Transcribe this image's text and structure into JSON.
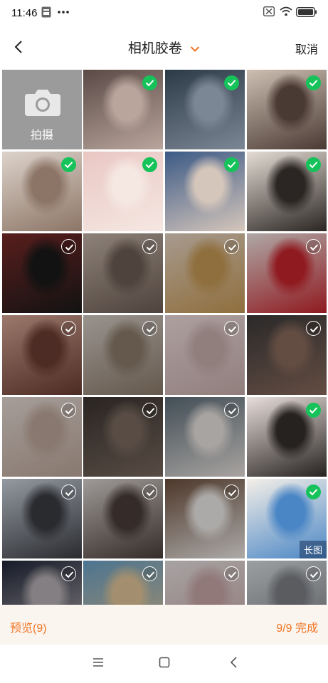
{
  "status": {
    "time": "11:46"
  },
  "header": {
    "back_icon": "chevron-left-icon",
    "title": "相机胶卷",
    "cancel": "取消",
    "accent": "#f07422"
  },
  "camera_tile": {
    "label": "拍摄",
    "icon": "camera-icon"
  },
  "photos": [
    {
      "selected": true,
      "colors": [
        "#5a4a46",
        "#b9a59c"
      ]
    },
    {
      "selected": true,
      "colors": [
        "#2c3a48",
        "#7c8795"
      ]
    },
    {
      "selected": true,
      "colors": [
        "#cdbfb2",
        "#4a3a34"
      ]
    },
    {
      "selected": true,
      "colors": [
        "#ddd3cb",
        "#8c7566"
      ]
    },
    {
      "selected": true,
      "colors": [
        "#e9c7c3",
        "#f5e7e2"
      ]
    },
    {
      "selected": true,
      "colors": [
        "#3c5a86",
        "#d5c6bb"
      ]
    },
    {
      "selected": true,
      "colors": [
        "#e4dcd4",
        "#2b2623"
      ]
    },
    {
      "selected": false,
      "colors": [
        "#7b2a28",
        "#1a1a1a"
      ]
    },
    {
      "selected": false,
      "colors": [
        "#c4b4a8",
        "#6e5e55"
      ]
    },
    {
      "selected": false,
      "colors": [
        "#e8d6c6",
        "#c79a55"
      ]
    },
    {
      "selected": false,
      "colors": [
        "#f2e9e6",
        "#c7252d"
      ]
    },
    {
      "selected": false,
      "colors": [
        "#d9a796",
        "#6a3d32"
      ]
    },
    {
      "selected": false,
      "colors": [
        "#d5cdc6",
        "#8c7b6b"
      ]
    },
    {
      "selected": false,
      "colors": [
        "#f0dede",
        "#c9b0ad"
      ]
    },
    {
      "selected": false,
      "colors": [
        "#3b3a3a",
        "#8a6b5d"
      ]
    },
    {
      "selected": false,
      "colors": [
        "#e6dbd5",
        "#bda79a"
      ]
    },
    {
      "selected": false,
      "colors": [
        "#3a3330",
        "#7a6a5f"
      ]
    },
    {
      "selected": false,
      "colors": [
        "#5c6d78",
        "#e9e3df"
      ]
    },
    {
      "selected": true,
      "colors": [
        "#e8dedb",
        "#262220"
      ]
    },
    {
      "selected": false,
      "colors": [
        "#cdd6e0",
        "#3b3c42"
      ]
    },
    {
      "selected": false,
      "colors": [
        "#dcd6d2",
        "#4a3e3a"
      ]
    },
    {
      "selected": false,
      "colors": [
        "#6b4d3b",
        "#efece9"
      ]
    },
    {
      "selected": true,
      "colors": [
        "#f4efe8",
        "#4a86c5"
      ],
      "tag": "长图"
    },
    {
      "selected": false,
      "colors": [
        "#1f2538",
        "#b7b1b4"
      ]
    },
    {
      "selected": false,
      "colors": [
        "#6aa2c8",
        "#e2c79a"
      ]
    },
    {
      "selected": false,
      "colors": [
        "#e8e2e2",
        "#caa8a8"
      ]
    },
    {
      "selected": false,
      "colors": [
        "#d9dde0",
        "#7d8086"
      ]
    }
  ],
  "footer": {
    "preview": "预览(9)",
    "done": "9/9 完成"
  },
  "system_nav": {
    "menu": "menu-icon",
    "home": "home-icon",
    "back": "back-icon"
  }
}
